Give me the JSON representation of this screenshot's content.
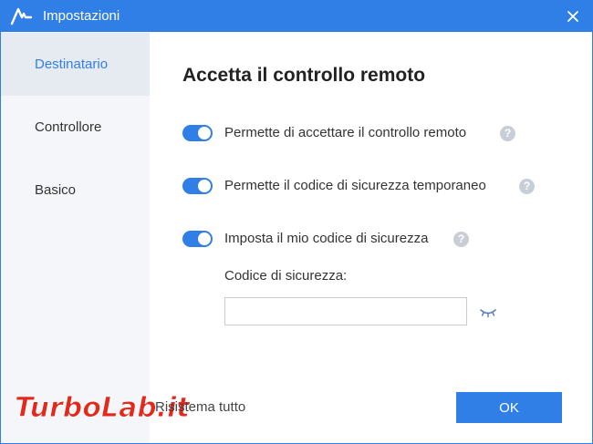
{
  "window": {
    "title": "Impostazioni",
    "accent": "#2f7fe6"
  },
  "sidebar": {
    "items": [
      {
        "label": "Destinatario",
        "active": true
      },
      {
        "label": "Controllore",
        "active": false
      },
      {
        "label": "Basico",
        "active": false
      }
    ]
  },
  "main": {
    "heading": "Accetta il controllo remoto",
    "options": [
      {
        "label": "Permette di accettare il controllo remoto",
        "enabled": true
      },
      {
        "label": "Permette il codice di sicurezza temporaneo",
        "enabled": true
      },
      {
        "label": "Imposta il mio codice di sicurezza",
        "enabled": true
      }
    ],
    "help_glyph": "?",
    "security_code_label": "Codice di sicurezza:",
    "security_code_value": ""
  },
  "footer": {
    "reset_label": "Risistema tutto",
    "ok_label": "OK"
  },
  "watermark": {
    "text": "TurboLab.it"
  },
  "icons": {
    "logo": "app-logo-icon",
    "close": "close-icon",
    "help": "help-icon",
    "eye": "eye-hidden-icon"
  }
}
